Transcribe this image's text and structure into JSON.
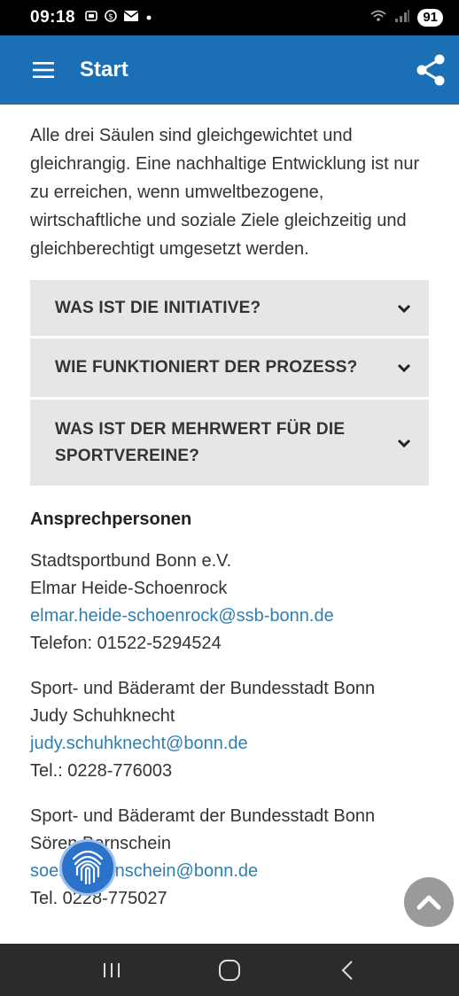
{
  "status_bar": {
    "time": "09:18",
    "left_icons": [
      "screenshot-icon",
      "vpn-icon",
      "mail-icon",
      "dot-icon"
    ],
    "battery": "91"
  },
  "app_bar": {
    "title": "Start",
    "menu_icon": "hamburger-icon",
    "share_icon": "share-icon",
    "color": "#1a6fb5"
  },
  "intro_text": "Alle drei Säulen sind gleichgewichtet und gleichrangig. Eine nachhaltige Entwicklung ist nur zu erreichen, wenn umweltbezogene, wirtschaftliche und soziale Ziele gleichzeitig und gleichberechtigt umgesetzt werden.",
  "accordion": [
    {
      "label": "WAS IST DIE INITIATIVE?"
    },
    {
      "label": "WIE FUNKTIONIERT DER PROZESS?"
    },
    {
      "label": "WAS IST DER MEHRWERT FÜR DIE SPORTVEREINE?"
    }
  ],
  "contacts": {
    "heading": "Ansprechpersonen",
    "items": [
      {
        "org": "Stadtsportbund Bonn e.V.",
        "name": "Elmar Heide-Schoenrock",
        "email": "elmar.heide-schoenrock@ssb-bonn.de",
        "phone": "Telefon: 01522-5294524"
      },
      {
        "org": "Sport- und Bäderamt der Bundesstadt Bonn",
        "name": "Judy Schuhknecht",
        "email": "judy.schuhknecht@bonn.de",
        "phone": "Tel.: 0228-776003"
      },
      {
        "org": "Sport- und Bäderamt der Bundesstadt Bonn",
        "name": "Sören Bernschein",
        "email": "soeren.bernschein@bonn.de",
        "phone": "Tel. 0228-775027"
      }
    ]
  },
  "link_color": "#2f7fb3",
  "floating": {
    "fingerprint_icon": "fingerprint-icon",
    "scroll_top_icon": "chevron-up-icon"
  },
  "nav_bar": [
    "recent-apps-icon",
    "home-icon",
    "back-icon"
  ]
}
